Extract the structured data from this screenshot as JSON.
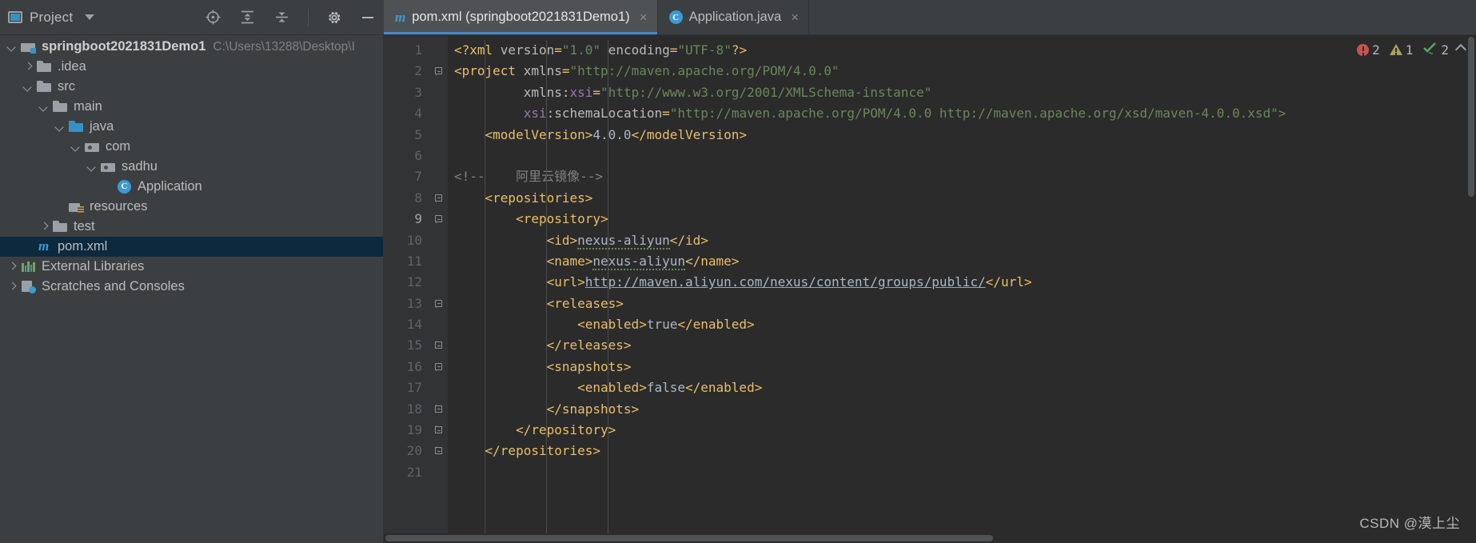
{
  "toolwindow": {
    "title": "Project",
    "icons": [
      "project-icon",
      "chevron-down-icon",
      "locate-icon",
      "expand-all-icon",
      "collapse-all-icon",
      "settings-gear-icon",
      "minimize-icon"
    ]
  },
  "tabs": [
    {
      "label": "pom.xml (springboot2021831Demo1)",
      "icon": "maven-icon",
      "active": true,
      "close": "×"
    },
    {
      "label": "Application.java",
      "icon": "java-class-icon",
      "active": false,
      "close": "×"
    }
  ],
  "tree": [
    {
      "label": "springboot2021831Demo1",
      "path": "C:\\Users\\13288\\Desktop\\I",
      "icon": "module-folder-icon",
      "arrow": "down",
      "indent": 0,
      "bold": true,
      "selected": false
    },
    {
      "label": ".idea",
      "path": "",
      "icon": "folder-icon",
      "arrow": "right",
      "indent": 1,
      "bold": false,
      "selected": false
    },
    {
      "label": "src",
      "path": "",
      "icon": "folder-icon",
      "arrow": "down",
      "indent": 1,
      "bold": false,
      "selected": false
    },
    {
      "label": "main",
      "path": "",
      "icon": "folder-icon",
      "arrow": "down",
      "indent": 2,
      "bold": false,
      "selected": false
    },
    {
      "label": "java",
      "path": "",
      "icon": "source-folder-icon",
      "arrow": "down",
      "indent": 3,
      "bold": false,
      "selected": false
    },
    {
      "label": "com",
      "path": "",
      "icon": "package-folder-icon",
      "arrow": "down",
      "indent": 4,
      "bold": false,
      "selected": false
    },
    {
      "label": "sadhu",
      "path": "",
      "icon": "package-folder-icon",
      "arrow": "down",
      "indent": 5,
      "bold": false,
      "selected": false
    },
    {
      "label": "Application",
      "path": "",
      "icon": "java-class-icon",
      "arrow": "none",
      "indent": 6,
      "bold": false,
      "selected": false
    },
    {
      "label": "resources",
      "path": "",
      "icon": "resources-folder-icon",
      "arrow": "none",
      "indent": 3,
      "bold": false,
      "selected": false
    },
    {
      "label": "test",
      "path": "",
      "icon": "folder-icon",
      "arrow": "right",
      "indent": 2,
      "bold": false,
      "selected": false
    },
    {
      "label": "pom.xml",
      "path": "",
      "icon": "maven-icon",
      "arrow": "none",
      "indent": 2,
      "bold": false,
      "selected": true
    },
    {
      "label": "External Libraries",
      "path": "",
      "icon": "libraries-icon",
      "arrow": "right",
      "indent": 0,
      "bold": false,
      "selected": false
    },
    {
      "label": "Scratches and Consoles",
      "path": "",
      "icon": "scratches-icon",
      "arrow": "right",
      "indent": 0,
      "bold": false,
      "selected": false
    }
  ],
  "editor": {
    "first_line": 1,
    "last_line": 21,
    "lines": [
      {
        "n": "1",
        "fold": "none",
        "tokens": [
          {
            "t": "tag",
            "v": "<?xml "
          },
          {
            "t": "attr",
            "v": "version"
          },
          {
            "t": "tag",
            "v": "="
          },
          {
            "t": "str",
            "v": "\"1.0\""
          },
          {
            "t": "attr",
            "v": " encoding"
          },
          {
            "t": "tag",
            "v": "="
          },
          {
            "t": "str",
            "v": "\"UTF-8\""
          },
          {
            "t": "tag",
            "v": "?>"
          }
        ],
        "indent": 1
      },
      {
        "n": "2",
        "fold": "start",
        "tokens": [
          {
            "t": "tag",
            "v": "<project "
          },
          {
            "t": "attr",
            "v": "xmlns"
          },
          {
            "t": "tag",
            "v": "="
          },
          {
            "t": "str",
            "v": "\"http://maven.apache.org/POM/4.0.0\""
          }
        ],
        "indent": 0
      },
      {
        "n": "3",
        "fold": "none",
        "tokens": [
          {
            "t": "plain",
            "v": "         "
          },
          {
            "t": "attr",
            "v": "xmlns:"
          },
          {
            "t": "attrns",
            "v": "xsi"
          },
          {
            "t": "tag",
            "v": "="
          },
          {
            "t": "str",
            "v": "\"http://www.w3.org/2001/XMLSchema-instance\""
          }
        ],
        "indent": 0
      },
      {
        "n": "4",
        "fold": "none",
        "tokens": [
          {
            "t": "plain",
            "v": "         "
          },
          {
            "t": "attrns",
            "v": "xsi"
          },
          {
            "t": "attr",
            "v": ":schemaLocation"
          },
          {
            "t": "tag",
            "v": "="
          },
          {
            "t": "str",
            "v": "\"http://maven.apache.org/POM/4.0.0 http://maven.apache.org/xsd/maven-4.0.0.xsd\">"
          }
        ],
        "indent": 0
      },
      {
        "n": "5",
        "fold": "none",
        "tokens": [
          {
            "t": "plain",
            "v": "    "
          },
          {
            "t": "tag",
            "v": "<modelVersion>"
          },
          {
            "t": "txt",
            "v": "4.0.0"
          },
          {
            "t": "tag",
            "v": "</modelVersion>"
          }
        ],
        "indent": 0
      },
      {
        "n": "6",
        "fold": "none",
        "tokens": [],
        "indent": 0
      },
      {
        "n": "7",
        "fold": "none",
        "tokens": [
          {
            "t": "cmt",
            "v": "<!--    阿里云镜像-->"
          }
        ],
        "indent": 0
      },
      {
        "n": "8",
        "fold": "start",
        "tokens": [
          {
            "t": "plain",
            "v": "    "
          },
          {
            "t": "tag",
            "v": "<repositories>"
          }
        ],
        "indent": 0
      },
      {
        "n": "9",
        "fold": "start",
        "tokens": [
          {
            "t": "plain",
            "v": "        "
          },
          {
            "t": "tag",
            "v": "<repository>"
          }
        ],
        "indent": 0
      },
      {
        "n": "10",
        "fold": "none",
        "tokens": [
          {
            "t": "plain",
            "v": "            "
          },
          {
            "t": "tag",
            "v": "<id>"
          },
          {
            "t": "spell",
            "v": "nexus-aliyun"
          },
          {
            "t": "tag",
            "v": "</id>"
          }
        ],
        "indent": 0
      },
      {
        "n": "11",
        "fold": "none",
        "tokens": [
          {
            "t": "plain",
            "v": "            "
          },
          {
            "t": "tag",
            "v": "<name>"
          },
          {
            "t": "spell",
            "v": "nexus-aliyun"
          },
          {
            "t": "tag",
            "v": "</name>"
          }
        ],
        "indent": 0
      },
      {
        "n": "12",
        "fold": "none",
        "tokens": [
          {
            "t": "plain",
            "v": "            "
          },
          {
            "t": "tag",
            "v": "<url>"
          },
          {
            "t": "link",
            "v": "http://maven.aliyun.com/nexus/content/groups/public/"
          },
          {
            "t": "tag",
            "v": "</url>"
          }
        ],
        "indent": 0
      },
      {
        "n": "13",
        "fold": "start",
        "tokens": [
          {
            "t": "plain",
            "v": "            "
          },
          {
            "t": "tag",
            "v": "<releases>"
          }
        ],
        "indent": 0
      },
      {
        "n": "14",
        "fold": "none",
        "tokens": [
          {
            "t": "plain",
            "v": "                "
          },
          {
            "t": "tag",
            "v": "<enabled>"
          },
          {
            "t": "txt",
            "v": "true"
          },
          {
            "t": "tag",
            "v": "</enabled>"
          }
        ],
        "indent": 0
      },
      {
        "n": "15",
        "fold": "end",
        "tokens": [
          {
            "t": "plain",
            "v": "            "
          },
          {
            "t": "tag",
            "v": "</releases>"
          }
        ],
        "indent": 0
      },
      {
        "n": "16",
        "fold": "start",
        "tokens": [
          {
            "t": "plain",
            "v": "            "
          },
          {
            "t": "tag",
            "v": "<snapshots>"
          }
        ],
        "indent": 0
      },
      {
        "n": "17",
        "fold": "none",
        "tokens": [
          {
            "t": "plain",
            "v": "                "
          },
          {
            "t": "tag",
            "v": "<enabled>"
          },
          {
            "t": "txt",
            "v": "false"
          },
          {
            "t": "tag",
            "v": "</enabled>"
          }
        ],
        "indent": 0
      },
      {
        "n": "18",
        "fold": "end",
        "tokens": [
          {
            "t": "plain",
            "v": "            "
          },
          {
            "t": "tag",
            "v": "</snapshots>"
          }
        ],
        "indent": 0
      },
      {
        "n": "19",
        "fold": "end",
        "tokens": [
          {
            "t": "plain",
            "v": "        "
          },
          {
            "t": "tag",
            "v": "</repository>"
          }
        ],
        "indent": 0
      },
      {
        "n": "20",
        "fold": "end",
        "tokens": [
          {
            "t": "plain",
            "v": "    "
          },
          {
            "t": "tag",
            "v": "</repositories>"
          }
        ],
        "indent": 0
      },
      {
        "n": "21",
        "fold": "none",
        "tokens": [],
        "indent": 0
      }
    ]
  },
  "inspections": {
    "errors": "2",
    "warnings": "1",
    "ok": "2",
    "collapse": "chevron-up-icon"
  },
  "watermark": "CSDN @漠上尘",
  "colors": {
    "accent": "#3592c4",
    "tab_underline": "#4a88c7",
    "selection": "#0d293e",
    "editor_bg": "#2b2b2b",
    "panel_bg": "#3c3f41",
    "gutter_bg": "#313335",
    "tag": "#e8bf6a",
    "string": "#6a8759",
    "attr_ns": "#9876aa",
    "text": "#a9b7c6",
    "comment": "#808080",
    "error": "#c75450",
    "warning": "#a9a05a",
    "ok": "#59a869"
  }
}
